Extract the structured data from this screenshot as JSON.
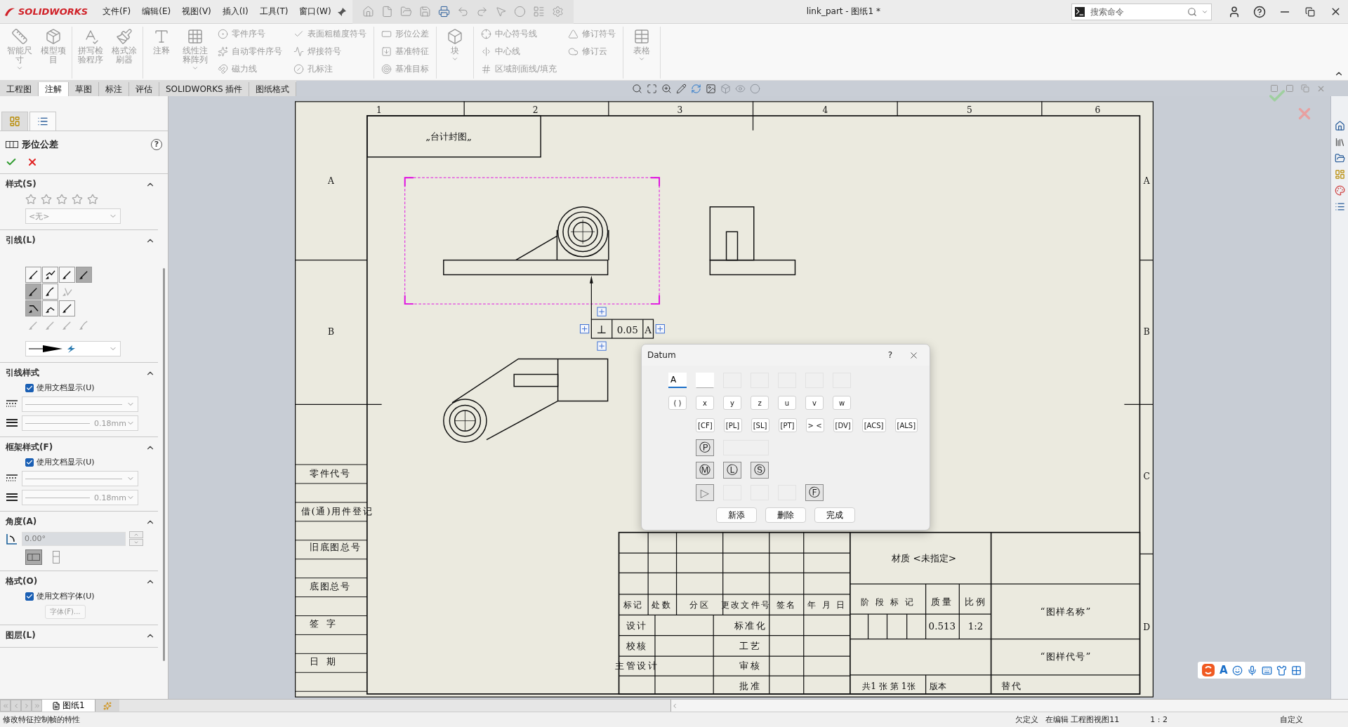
{
  "app": {
    "logo": "SOLIDWORKS",
    "menus": [
      "文件(F)",
      "编辑(E)",
      "视图(V)",
      "插入(I)",
      "工具(T)",
      "窗口(W)"
    ],
    "title": "link_part - 图纸1 *",
    "search": {
      "placeholder": "搜索命令"
    }
  },
  "ribbon": {
    "groups": [
      [
        {
          "kind": "large",
          "label": "智能尺寸",
          "dropdown": true
        },
        {
          "kind": "large",
          "label": "模型项目",
          "dropdown": false
        }
      ],
      [
        {
          "kind": "large",
          "label": "拼写检验程序",
          "dropdown": false
        },
        {
          "kind": "large",
          "label": "格式涂刷器",
          "dropdown": false
        }
      ],
      [
        {
          "kind": "large",
          "label": "注释",
          "dropdown": false
        },
        {
          "kind": "large",
          "label": "线性注释阵列",
          "dropdown": true
        },
        {
          "kind": "stack",
          "items": [
            "零件序号",
            "自动零件序号",
            "磁力线"
          ]
        },
        {
          "kind": "stack",
          "items": [
            "表面粗糙度符号",
            "焊接符号",
            "孔标注"
          ]
        }
      ],
      [
        {
          "kind": "stack",
          "items": [
            "形位公差",
            "基准特征",
            "基准目标"
          ]
        }
      ],
      [
        {
          "kind": "large",
          "label": "块",
          "dropdown": true
        }
      ],
      [
        {
          "kind": "stack",
          "items": [
            "中心符号线",
            "中心线",
            "区域剖面线/填充"
          ]
        },
        {
          "kind": "stack",
          "items": [
            "修订符号",
            "修订云"
          ]
        }
      ],
      [
        {
          "kind": "large",
          "label": "表格",
          "dropdown": true
        }
      ]
    ]
  },
  "tabs": [
    {
      "label": "工程图",
      "selected": false
    },
    {
      "label": "注解",
      "selected": true
    },
    {
      "label": "草图",
      "selected": false
    },
    {
      "label": "标注",
      "selected": false
    },
    {
      "label": "评估",
      "selected": false
    },
    {
      "label": "SOLIDWORKS 插件",
      "selected": false
    },
    {
      "label": "图纸格式",
      "selected": false
    }
  ],
  "property_manager": {
    "tabs": [
      {
        "selected": false
      },
      {
        "selected": true
      }
    ],
    "title": "形位公差",
    "help": "?",
    "style_section": {
      "title": "样式(S)",
      "expanded": true,
      "value": "<无>"
    },
    "leader_section": {
      "title": "引线(L)",
      "expanded": true,
      "rows": [
        [
          {
            "selected": false,
            "disabled": false
          },
          {
            "selected": false,
            "disabled": false
          },
          {
            "selected": false,
            "disabled": false
          },
          {
            "selected": true,
            "disabled": false
          }
        ],
        [
          {
            "selected": true,
            "disabled": false
          },
          {
            "selected": false,
            "disabled": false
          },
          {
            "selected": false,
            "disabled": true
          }
        ],
        [
          {
            "selected": true,
            "disabled": false
          },
          {
            "selected": false,
            "disabled": false
          },
          {
            "selected": false,
            "disabled": false
          }
        ],
        [
          {
            "selected": false,
            "disabled": true
          },
          {
            "selected": false,
            "disabled": true
          },
          {
            "selected": false,
            "disabled": true
          },
          {
            "selected": false,
            "disabled": true
          }
        ]
      ]
    },
    "leader_style": {
      "title": "引线样式",
      "expanded": true,
      "checkbox": {
        "label": "使用文档显示(U)",
        "checked": true
      },
      "thickness": "0.18mm"
    },
    "frame_style": {
      "title": "框架样式(F)",
      "expanded": true,
      "checkbox": {
        "label": "使用文档显示(U)",
        "checked": true
      },
      "thickness": "0.18mm"
    },
    "angle": {
      "title": "角度(A)",
      "expanded": true,
      "value": "0.00°",
      "orientation": [
        {
          "selected": true
        },
        {
          "selected": false
        }
      ]
    },
    "format": {
      "title": "格式(O)",
      "expanded": true,
      "checkbox": {
        "label": "使用文档字体(U)",
        "checked": true
      },
      "font_button": "字体(F)..."
    },
    "layer": {
      "title": "图层(L)",
      "expanded": true
    }
  },
  "drawing": {
    "zone_columns": [
      "1",
      "2",
      "3",
      "4",
      "5",
      "6"
    ],
    "zone_rows_right": [
      "A",
      "B",
      "C",
      "D"
    ],
    "zone_rows_left": [
      "A",
      "B"
    ],
    "stamp": "„台计封图„",
    "left_table": [
      "零件代号",
      "借(通)用件登记",
      "旧底图总号",
      "底图总号",
      "签 字",
      "日 期"
    ],
    "gdt_frame": {
      "symbol": "⊥",
      "tolerance": "0.05",
      "datum": "A"
    },
    "title_block": {
      "material": "材质 <未指定>",
      "revision_headers": [
        "标记",
        "处数",
        "分区",
        "更改文件号",
        "签名",
        "年 月 日"
      ],
      "approval_left": [
        "设计",
        "校核",
        "主管设计"
      ],
      "approval_right": [
        "标准化",
        "工艺",
        "审核",
        "批准"
      ],
      "stage_label": "阶 段 标 记",
      "mass_label": "质量",
      "scale_label": "比例",
      "mass": "0.513",
      "scale": "1:2",
      "sheet_info": "共1 张 第 1张",
      "version_label": "版本",
      "replace_label": "替代",
      "drawing_name": "“图样名称”",
      "drawing_number": "“图样代号”"
    }
  },
  "datum_dialog": {
    "title": "Datum",
    "help": "?",
    "value": "A",
    "modifiers": [
      "( )",
      "x",
      "y",
      "z",
      "u",
      "v",
      "w"
    ],
    "features": [
      "[CF]",
      "[PL]",
      "[SL]",
      "[PT]",
      "> <",
      "[DV]",
      "[ACS]",
      "[ALS]"
    ],
    "projected": "Ⓟ",
    "material_conditions": [
      "Ⓜ",
      "Ⓛ",
      "Ⓢ"
    ],
    "flag": "▷",
    "free_state": "Ⓕ",
    "buttons": [
      "新添",
      "删除",
      "完成"
    ]
  },
  "ime_bar": {
    "label": "A"
  },
  "sheet_tabs": [
    {
      "label": "图纸1",
      "selected": true
    }
  ],
  "status_bar": {
    "message": "修改特征控制帧的特性",
    "fields": [
      "欠定义",
      "在编辑 工程图视图11",
      "1 : 2",
      "自定义"
    ]
  }
}
